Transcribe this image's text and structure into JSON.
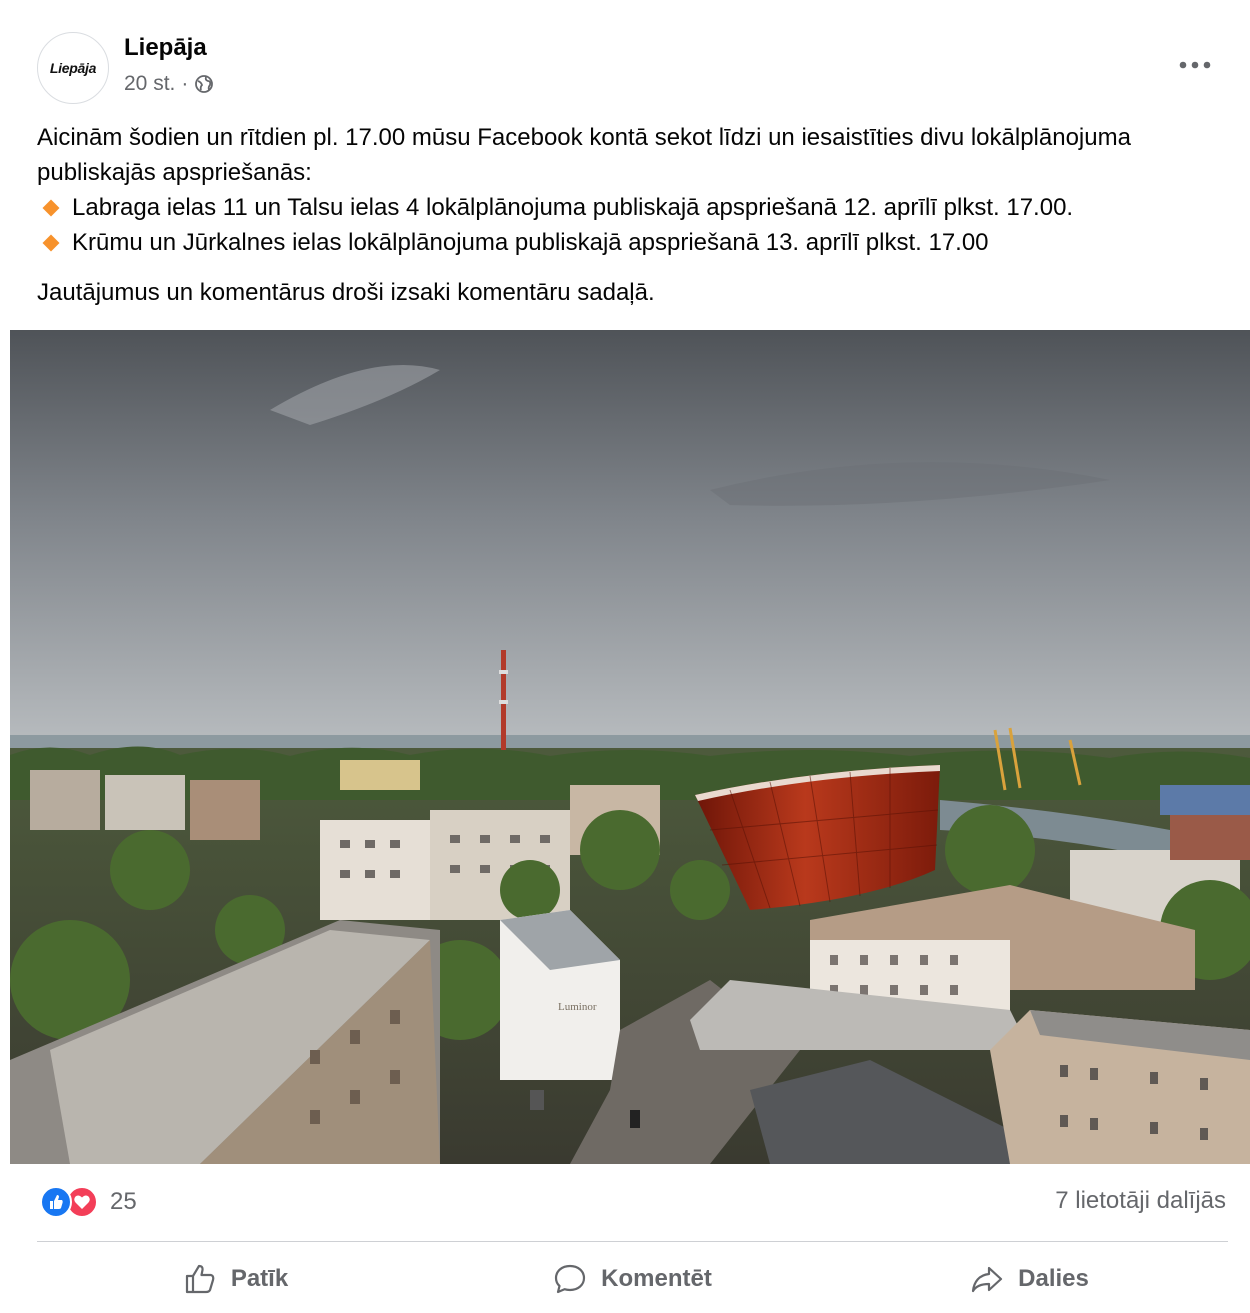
{
  "post": {
    "page_name": "Liepāja",
    "avatar_text": "Liepāja",
    "time": "20 st.",
    "separator": "·",
    "body": {
      "intro": "Aicinām šodien un rītdien pl. 17.00 mūsu Facebook kontā sekot līdzi un iesaistīties divu lokālplānojuma publiskajās apspriešanās:",
      "bullets": [
        "Labraga ielas 11 un Talsu ielas 4 lokālplānojuma publiskajā apspriešanā 12. aprīlī plkst. 17.00.",
        "Krūmu un Jūrkalnes ielas lokālplānojuma publiskajā apspriešanā 13. aprīlī plkst. 17.00"
      ],
      "closing": "Jautājumus un komentārus droši izsaki komentāru sadaļā."
    },
    "photo": {
      "sign_text": "Luminor"
    },
    "stats": {
      "reaction_count": "25",
      "shares": "7 lietotāji dalījās"
    },
    "actions": {
      "like": "Patīk",
      "comment": "Komentēt",
      "share": "Dalies"
    }
  },
  "colors": {
    "bullet": "#f7922c",
    "like": "#1877f2",
    "love": "#f33e58",
    "secondary_text": "#65676b"
  },
  "icons": {
    "privacy": "globe-icon",
    "more": "more-horizontal-icon",
    "like": "thumbs-up-icon",
    "comment": "comment-bubble-icon",
    "share": "share-arrow-icon"
  }
}
